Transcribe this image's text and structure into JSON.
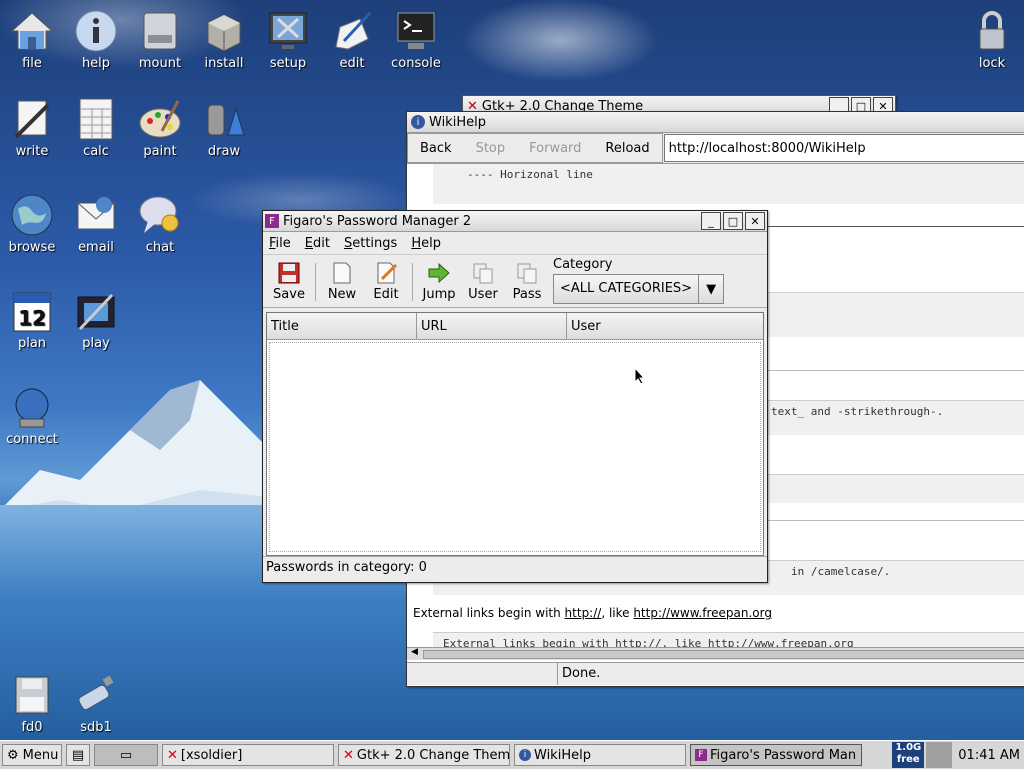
{
  "desktop": {
    "icons": [
      {
        "label": "file",
        "icon": "house-icon"
      },
      {
        "label": "help",
        "icon": "info-icon"
      },
      {
        "label": "mount",
        "icon": "drive-icon"
      },
      {
        "label": "install",
        "icon": "box-icon"
      },
      {
        "label": "setup",
        "icon": "tools-icon"
      },
      {
        "label": "edit",
        "icon": "pen-icon"
      },
      {
        "label": "console",
        "icon": "terminal-icon"
      },
      {
        "label": "lock",
        "icon": "padlock-icon"
      },
      {
        "label": "write",
        "icon": "write-icon"
      },
      {
        "label": "calc",
        "icon": "spreadsheet-icon"
      },
      {
        "label": "paint",
        "icon": "palette-icon"
      },
      {
        "label": "draw",
        "icon": "draw-icon"
      },
      {
        "label": "browse",
        "icon": "globe-icon"
      },
      {
        "label": "email",
        "icon": "envelope-icon"
      },
      {
        "label": "chat",
        "icon": "chat-bubble-icon"
      },
      {
        "label": "plan",
        "icon": "calendar-icon"
      },
      {
        "label": "play",
        "icon": "film-icon"
      },
      {
        "label": "connect",
        "icon": "network-globe-icon"
      },
      {
        "label": "fd0",
        "icon": "floppy-icon"
      },
      {
        "label": "sdb1",
        "icon": "usb-drive-icon"
      }
    ],
    "calendar_day": "12"
  },
  "gtk_window": {
    "title": "Gtk+ 2.0 Change Theme"
  },
  "wiki_window": {
    "title": "WikiHelp",
    "nav": {
      "back": "Back",
      "stop": "Stop",
      "forward": "Forward",
      "reload": "Reload"
    },
    "url": "http://localhost:8000/WikiHelp",
    "code_line1": "---- Horizonal line",
    "code_line2": "text_ and -strikethrough-.",
    "code_line3": "in /camelcase/.",
    "ext_text": "External links begin with http://, like http://www.freepan.org",
    "ext_prefix": "External links begin with ",
    "ext_link1": "http://",
    "ext_mid": ", like ",
    "ext_link2": "http://www.freepan.org",
    "code_line4": "External links begin with http://, like http://www.freepan.org",
    "status": "Done."
  },
  "fpm_window": {
    "title": "Figaro's Password Manager 2",
    "menu": [
      "File",
      "Edit",
      "Settings",
      "Help"
    ],
    "toolbar": {
      "save": "Save",
      "new": "New",
      "edit": "Edit",
      "jump": "Jump",
      "user": "User",
      "pass": "Pass"
    },
    "category_label": "Category",
    "category_value": "<ALL CATEGORIES>",
    "columns": [
      "Title",
      "URL",
      "User"
    ],
    "status": "Passwords in category: 0"
  },
  "taskbar": {
    "menu": "Menu",
    "tasks": [
      "[xsoldier]",
      "Gtk+ 2.0 Change Theme",
      "WikiHelp",
      "Figaro's Password Man"
    ],
    "free_size": "1.0G",
    "free_label": "free",
    "clock": "01:41 AM"
  },
  "colors": {
    "accent": "#1d3f7a",
    "link": "#0000cc",
    "taskbar": "#d6d6d6"
  }
}
